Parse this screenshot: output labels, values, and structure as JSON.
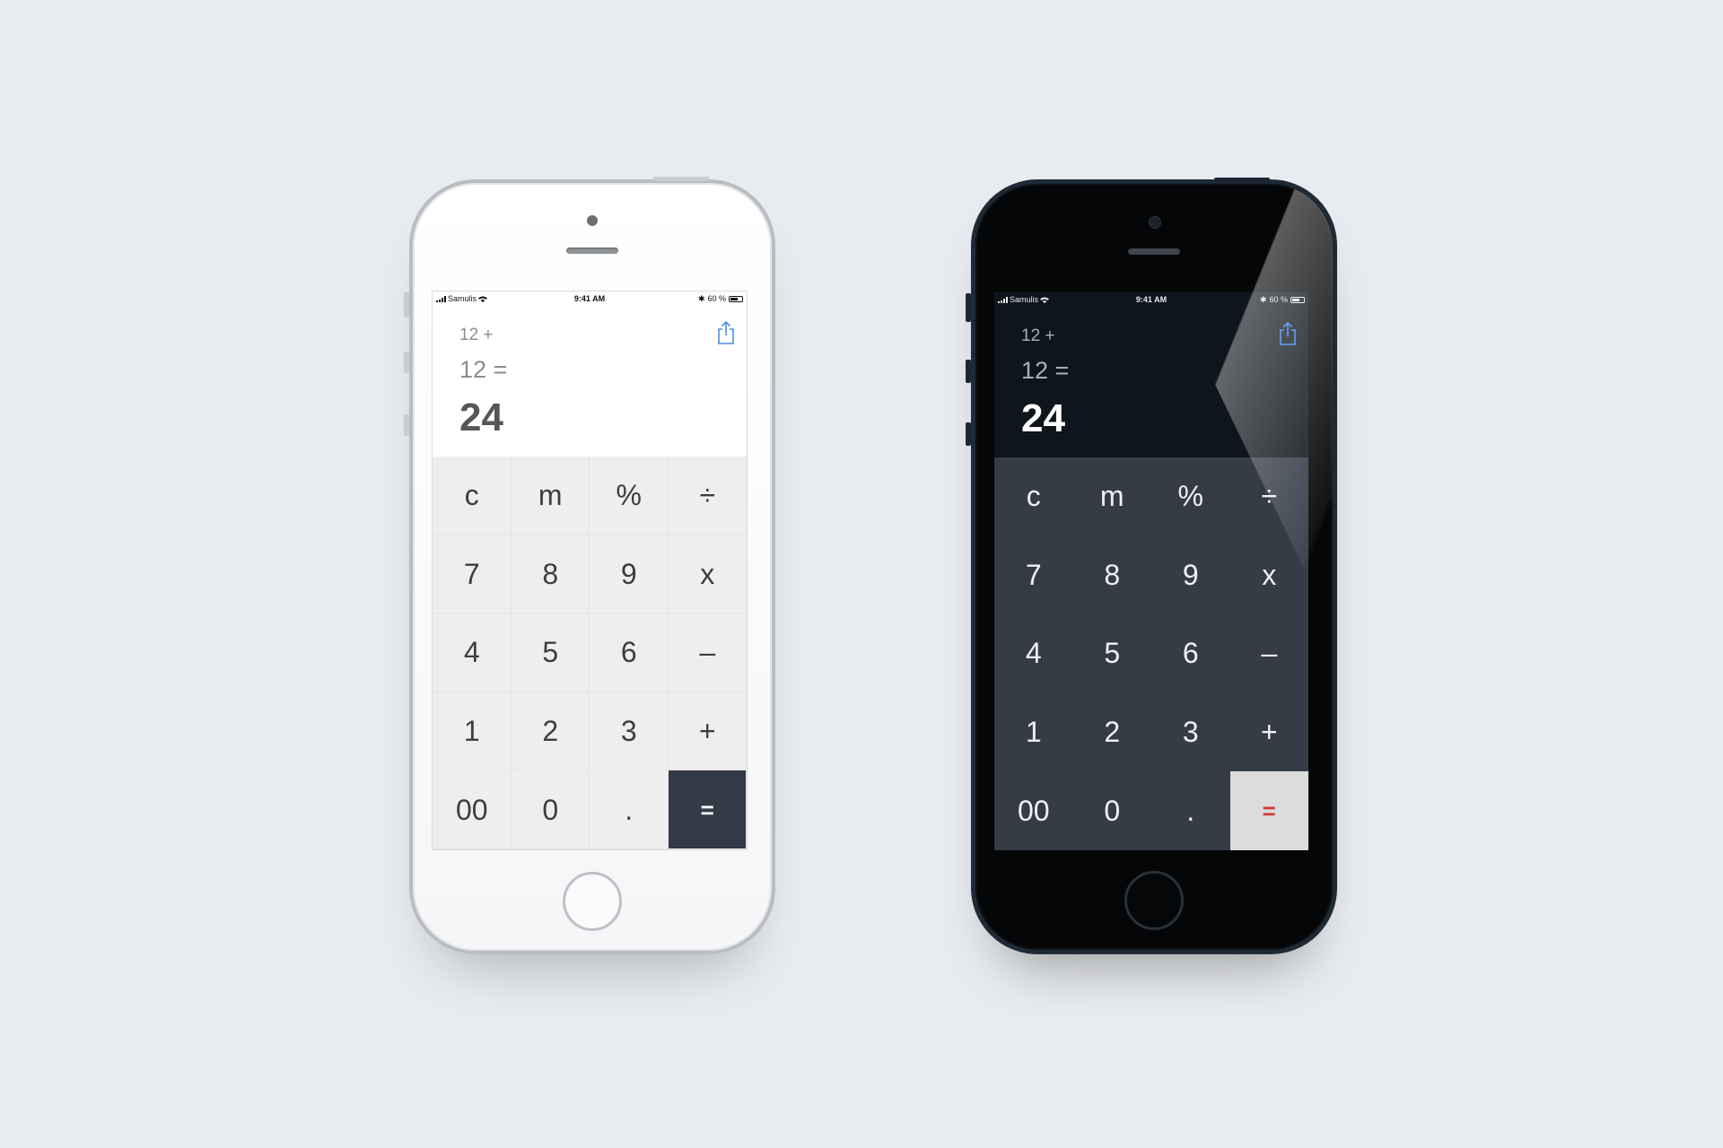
{
  "scene": {
    "background": "#e8ebef"
  },
  "phones": [
    {
      "theme": "light",
      "status_bar": {
        "carrier": "Samulis",
        "time": "9:41 AM",
        "battery": "60 %"
      },
      "display": {
        "expression_line1": "12 +",
        "expression_line2": "12 =",
        "result": "24"
      },
      "share_icon": "share-icon",
      "accent": "#4a90d9",
      "keys": [
        "c",
        "m",
        "%",
        "÷",
        "7",
        "8",
        "9",
        "x",
        "4",
        "5",
        "6",
        "–",
        "1",
        "2",
        "3",
        "+",
        "00",
        "0",
        ".",
        "="
      ]
    },
    {
      "theme": "dark",
      "status_bar": {
        "carrier": "Samulis",
        "time": "9:41 AM",
        "battery": "60 %"
      },
      "display": {
        "expression_line1": "12 +",
        "expression_line2": "12 =",
        "result": "24"
      },
      "share_icon": "share-icon",
      "accent": "#2f80ed",
      "keys": [
        "c",
        "m",
        "%",
        "÷",
        "7",
        "8",
        "9",
        "x",
        "4",
        "5",
        "6",
        "–",
        "1",
        "2",
        "3",
        "+",
        "00",
        "0",
        ".",
        "="
      ]
    }
  ]
}
